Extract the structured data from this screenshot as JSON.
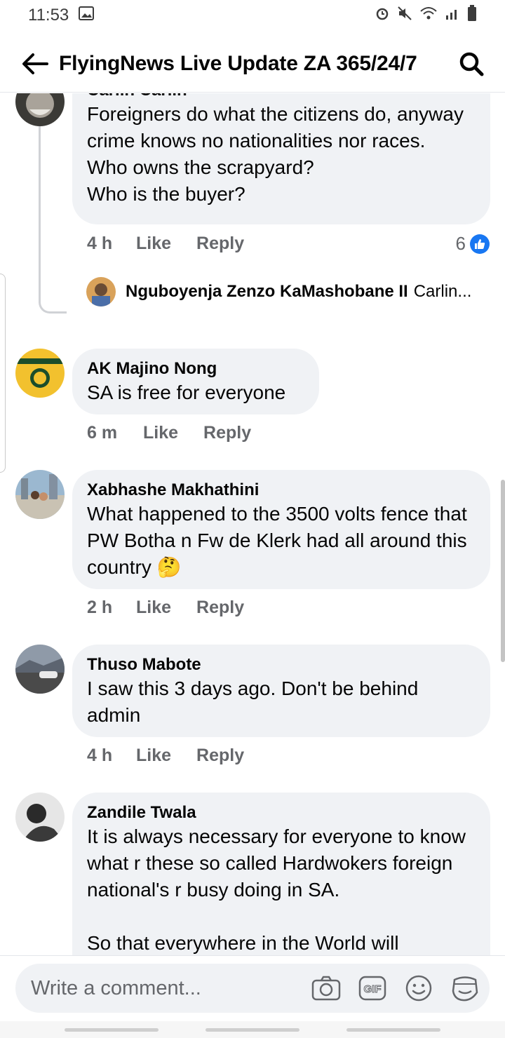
{
  "status_bar": {
    "time": "11:53"
  },
  "header": {
    "title": "FlyingNews Live Update ZA 365/24/7"
  },
  "comments": [
    {
      "author": "Carlin Carlin",
      "text": "Foreigners do what the citizens do, anyway crime knows no nationalities nor races.\nWho owns the scrapyard?\nWho is the buyer?",
      "time": "4 h",
      "like": "Like",
      "reply": "Reply",
      "reactions": "6",
      "reply_preview": {
        "name": "Nguboyenja Zenzo KaMashobane II",
        "snippet": "Carlin..."
      }
    },
    {
      "author": "AK Majino Nong",
      "text": "SA is free for everyone",
      "time": "6 m",
      "like": "Like",
      "reply": "Reply"
    },
    {
      "author": "Xabhashe Makhathini",
      "text": "What happened to the 3500 volts fence that PW  Botha n Fw de Klerk had all around this country 🤔",
      "time": "2 h",
      "like": "Like",
      "reply": "Reply"
    },
    {
      "author": "Thuso Mabote",
      "text": "I saw this 3 days ago. Don't be behind admin",
      "time": "4 h",
      "like": "Like",
      "reply": "Reply"
    },
    {
      "author": "Zandile Twala",
      "text": "It is always necessary for everyone to know what r these so called Hardwokers foreign national's r busy doing in SA.\n\nSo that everywhere in the  World will",
      "time": "",
      "like": "",
      "reply": ""
    }
  ],
  "composer": {
    "placeholder": "Write a comment..."
  },
  "icons": [
    "back-arrow-icon",
    "search-icon",
    "like-thumb-icon",
    "camera-icon",
    "gif-icon",
    "emoji-icon",
    "sticker-icon"
  ],
  "colors": {
    "bubble": "#f0f2f5",
    "accent": "#1877f2",
    "meta": "#65676b"
  }
}
